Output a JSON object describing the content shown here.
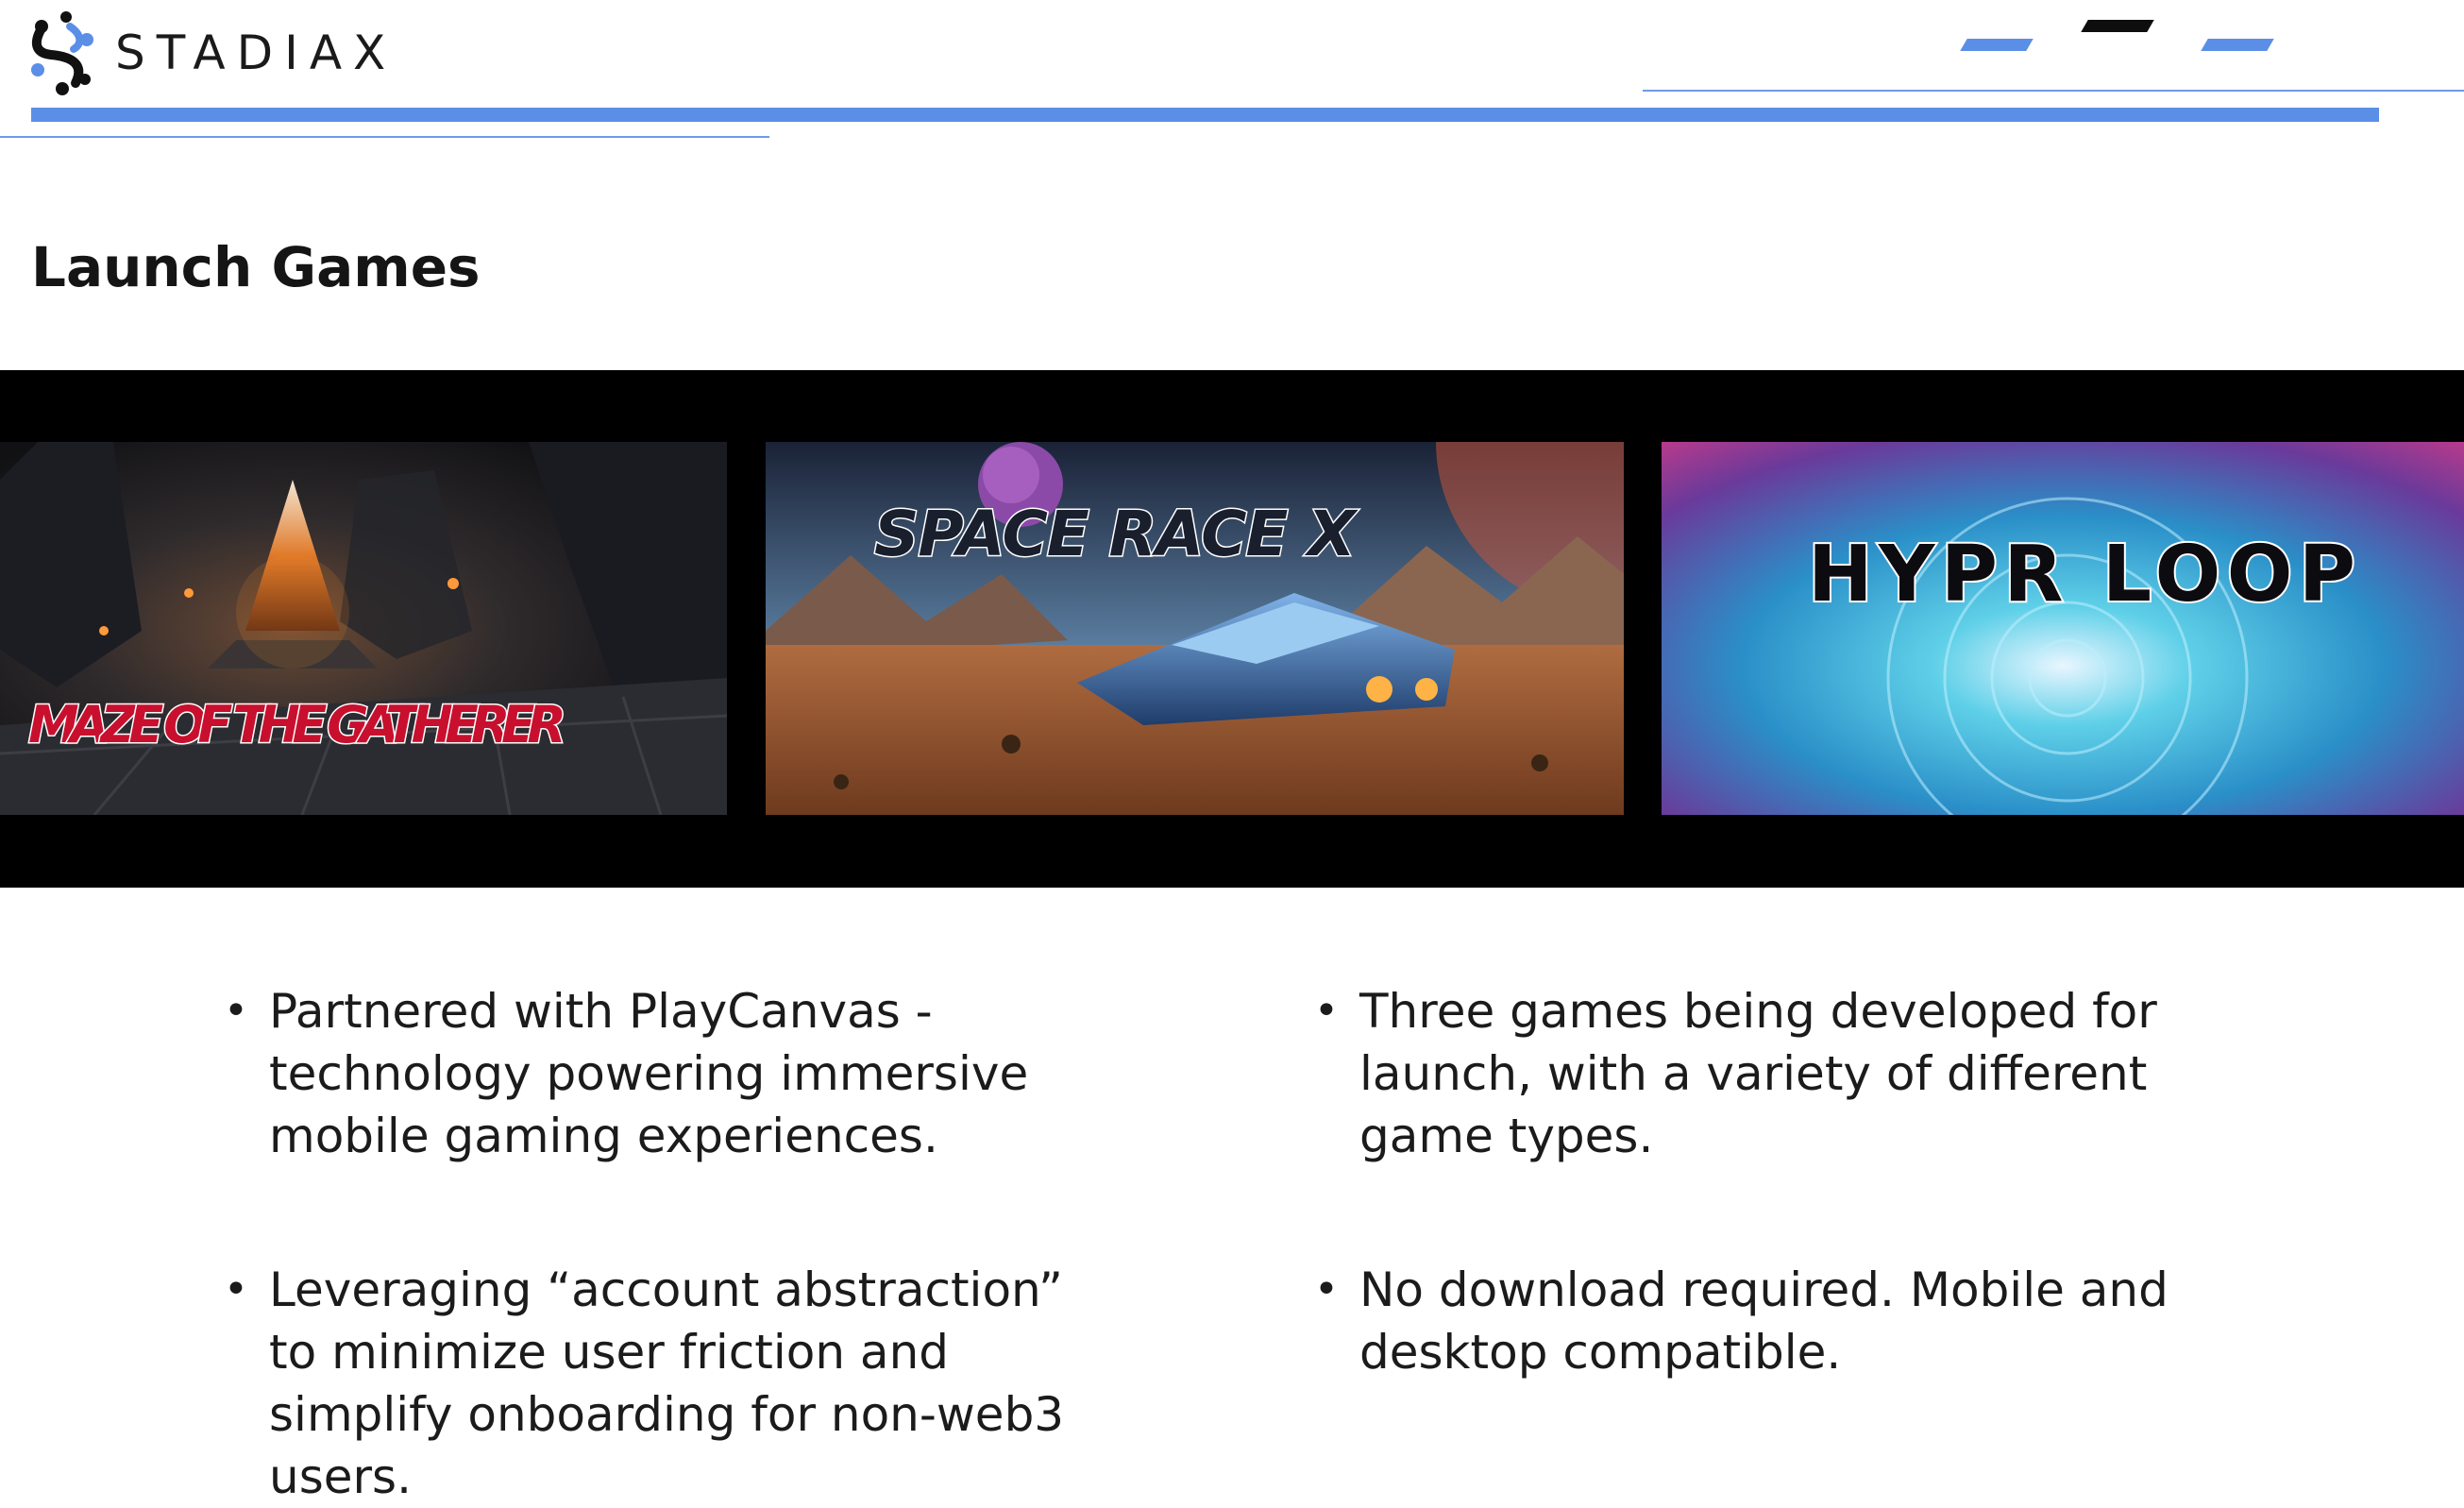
{
  "header": {
    "brand_name": "STADIAX",
    "brand_color": "#5b8ee6",
    "logo_icon": "stadiax-logo-icon"
  },
  "page": {
    "title": "Launch Games"
  },
  "games": [
    {
      "title": "MAZE OF THE GATHERER"
    },
    {
      "title": "SPACE RACE X"
    },
    {
      "title": "HYPR LOOP"
    }
  ],
  "bullets": [
    {
      "text": "Partnered with PlayCanvas - technology powering immersive mobile gaming experiences."
    },
    {
      "text": "Three games being developed for launch, with a variety of different game types."
    },
    {
      "text": "Leveraging “account abstraction” to minimize user friction and simplify onboarding for non-web3 users."
    },
    {
      "text": "No download required. Mobile and desktop compatible."
    }
  ],
  "bullet_glyph": "•"
}
